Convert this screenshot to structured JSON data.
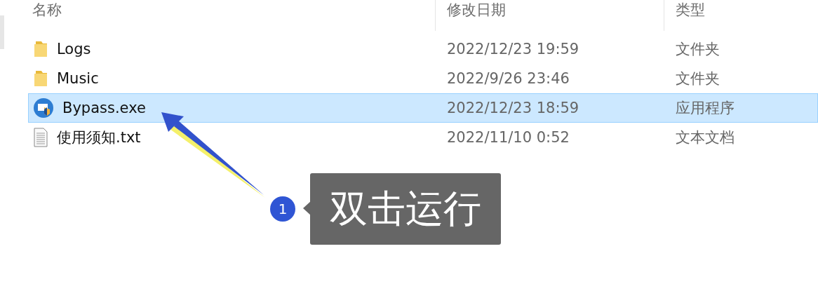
{
  "columns": [
    {
      "label": "名称"
    },
    {
      "label": "修改日期"
    },
    {
      "label": "类型"
    }
  ],
  "files": [
    {
      "kind": "folder",
      "name": "Logs",
      "date": "2022/12/23 19:59",
      "type": "文件夹",
      "selected": false
    },
    {
      "kind": "folder",
      "name": "Music",
      "date": "2022/9/26 23:46",
      "type": "文件夹",
      "selected": false
    },
    {
      "kind": "exe",
      "name": "Bypass.exe",
      "date": "2022/12/23 18:59",
      "type": "应用程序",
      "selected": true
    },
    {
      "kind": "text",
      "name": "使用须知.txt",
      "date": "2022/11/10 0:52",
      "type": "文本文档",
      "selected": false
    }
  ],
  "annotation": {
    "step": "1",
    "text": "双击运行"
  }
}
